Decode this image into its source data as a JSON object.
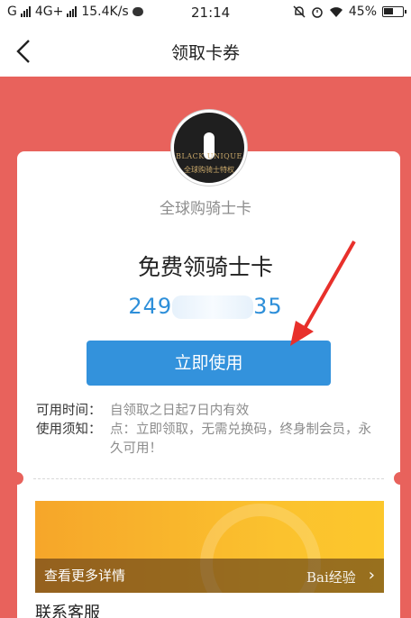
{
  "statusbar": {
    "carrier": "G",
    "network": "4G+",
    "speed": "15.4K/s",
    "time": "21:14",
    "battery": "45%"
  },
  "navbar": {
    "title": "领取卡券"
  },
  "logo": {
    "monogram": "",
    "brand": "BLACK UNIQUE",
    "brand_cn": "全球购骑士特权"
  },
  "card": {
    "name": "全球购骑士卡",
    "headline": "免费领骑士卡",
    "code_prefix": "249",
    "code_suffix": "35",
    "use_button": "立即使用",
    "info": [
      {
        "label": "可用时间：",
        "value": "自领取之日起7日内有效"
      },
      {
        "label": "使用须知：",
        "value": "点：立即领取，无需兑换码，终身制会员，永久可用！"
      }
    ],
    "banner_link": "查看更多详情",
    "contact": "联系客服"
  },
  "watermark": "Bai经验",
  "colors": {
    "background": "#e8625c",
    "accent": "#3392dc",
    "arrow": "#e8302b"
  }
}
